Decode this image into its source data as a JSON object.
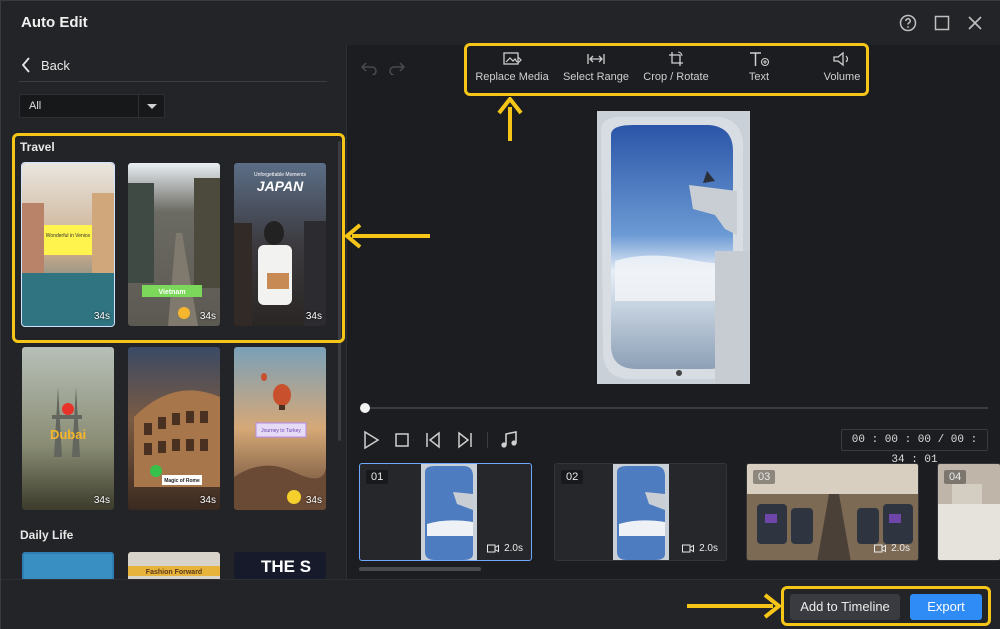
{
  "window": {
    "title": "Auto Edit",
    "controls": [
      "help-icon",
      "maximize-icon",
      "close-icon"
    ]
  },
  "sidebar": {
    "back_label": "Back",
    "filter_value": "All",
    "sections": [
      {
        "label": "Travel"
      },
      {
        "label": "Daily Life"
      }
    ],
    "templates": [
      {
        "duration": "34s",
        "caption": "Wonderful in Venice"
      },
      {
        "duration": "34s",
        "caption": "Vietnam"
      },
      {
        "duration": "34s",
        "caption": "JAPAN",
        "subcaption": "Unforgettable Moments"
      },
      {
        "duration": "34s",
        "caption": "Dubai"
      },
      {
        "duration": "34s",
        "caption": "Magic of Rome"
      },
      {
        "duration": "34s",
        "caption": "Journey to Turkey"
      }
    ],
    "daily_thumbs": [
      {
        "caption": ""
      },
      {
        "caption": "Fashion Forward"
      },
      {
        "caption": "THE S"
      }
    ]
  },
  "toolbar": {
    "tools": [
      {
        "label": "Replace Media",
        "icon": "replace-media-icon"
      },
      {
        "label": "Select Range",
        "icon": "select-range-icon"
      },
      {
        "label": "Crop / Rotate",
        "icon": "crop-rotate-icon"
      },
      {
        "label": "Text",
        "icon": "text-icon"
      },
      {
        "label": "Volume",
        "icon": "volume-icon"
      }
    ]
  },
  "player": {
    "timecode": "00 : 00 : 00 / 00 : 34 : 01",
    "progress": 0.0
  },
  "clips": [
    {
      "index": "01",
      "duration": "2.0s"
    },
    {
      "index": "02",
      "duration": "2.0s"
    },
    {
      "index": "03",
      "duration": "2.0s"
    },
    {
      "index": "04",
      "duration": ""
    }
  ],
  "footer": {
    "add_to_timeline": "Add to Timeline",
    "export": "Export"
  },
  "colors": {
    "accent": "#2f8bf5",
    "highlight": "#f5c518",
    "background": "#1e1f22"
  }
}
